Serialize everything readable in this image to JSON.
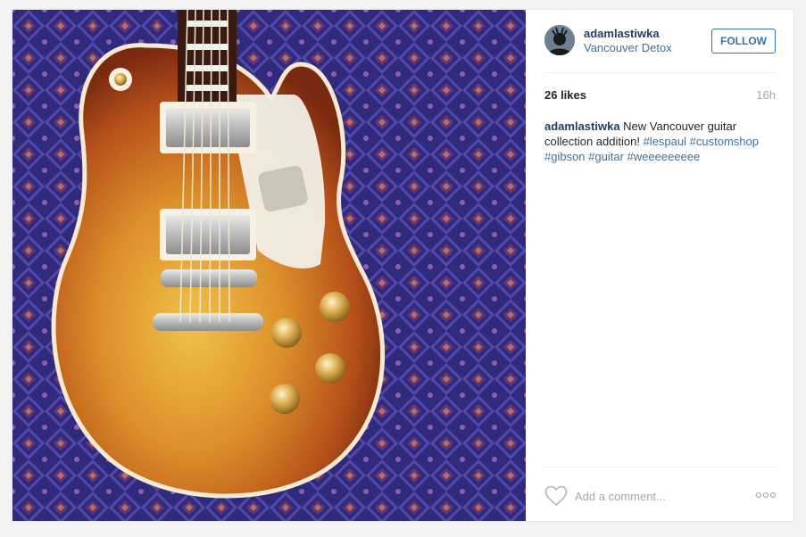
{
  "post": {
    "image_alt_icon": "guitar-photo",
    "author": {
      "username": "adamlastiwka",
      "location": "Vancouver Detox",
      "avatar_icon": "profile-avatar"
    },
    "follow_label": "FOLLOW",
    "likes": "26 likes",
    "time_ago": "16h",
    "caption": {
      "username": "adamlastiwka",
      "text": " New Vancouver guitar collection addition! ",
      "tags": [
        "#lespaul",
        "#customshop",
        "#gibson",
        "#guitar",
        "#weeeeeeeee"
      ]
    },
    "comment_placeholder": "Add a comment...",
    "colors": {
      "link": "#3f729b",
      "username": "#1f3f63",
      "muted": "#a5a7aa",
      "border": "#efefef"
    }
  }
}
